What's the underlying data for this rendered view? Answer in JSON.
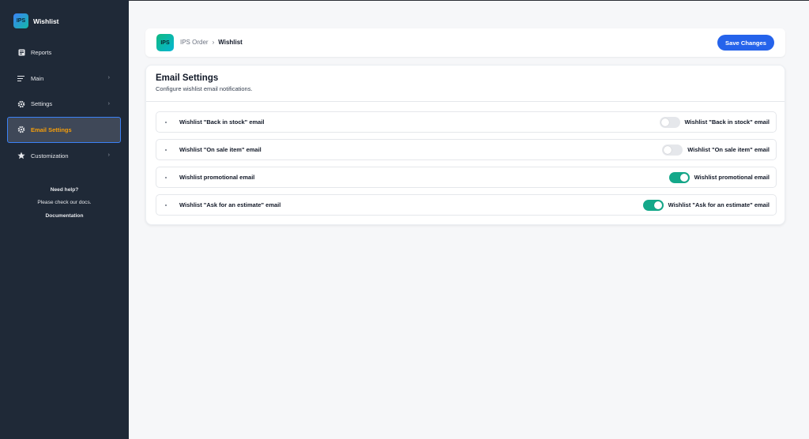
{
  "sidebar": {
    "brand_logo": "IPS",
    "brand_name": "Wishlist",
    "items": [
      {
        "label": "Reports",
        "icon": "reports-icon"
      },
      {
        "label": "Main",
        "icon": "list-icon"
      },
      {
        "label": "Settings",
        "icon": "gear-icon"
      },
      {
        "label": "Email Settings",
        "icon": "gear-icon"
      },
      {
        "label": "Customization",
        "icon": "star-icon"
      }
    ],
    "help": {
      "title": "Need help?",
      "text": "Please check our docs.",
      "link": "Documentation"
    }
  },
  "header": {
    "logo": "IPS",
    "breadcrumb_parent": "IPS Order",
    "breadcrumb_separator": "›",
    "breadcrumb_current": "Wishlist",
    "save_label": "Save Changes"
  },
  "email_settings": {
    "title": "Email Settings",
    "subtitle": "Configure wishlist email notifications.",
    "rows": [
      {
        "label": "Wishlist \"Back in stock\" email",
        "toggle_label": "Wishlist \"Back in stock\" email",
        "enabled": false
      },
      {
        "label": "Wishlist \"On sale item\" email",
        "toggle_label": "Wishlist \"On sale item\" email",
        "enabled": false
      },
      {
        "label": "Wishlist promotional email",
        "toggle_label": "Wishlist promotional email",
        "enabled": true
      },
      {
        "label": "Wishlist \"Ask for an estimate\" email",
        "toggle_label": "Wishlist \"Ask for an estimate\" email",
        "enabled": true
      }
    ]
  },
  "colors": {
    "sidebar_bg": "#1f2937",
    "active_text": "#f59e0b",
    "primary": "#2563eb",
    "toggle_on": "#14a88a"
  }
}
